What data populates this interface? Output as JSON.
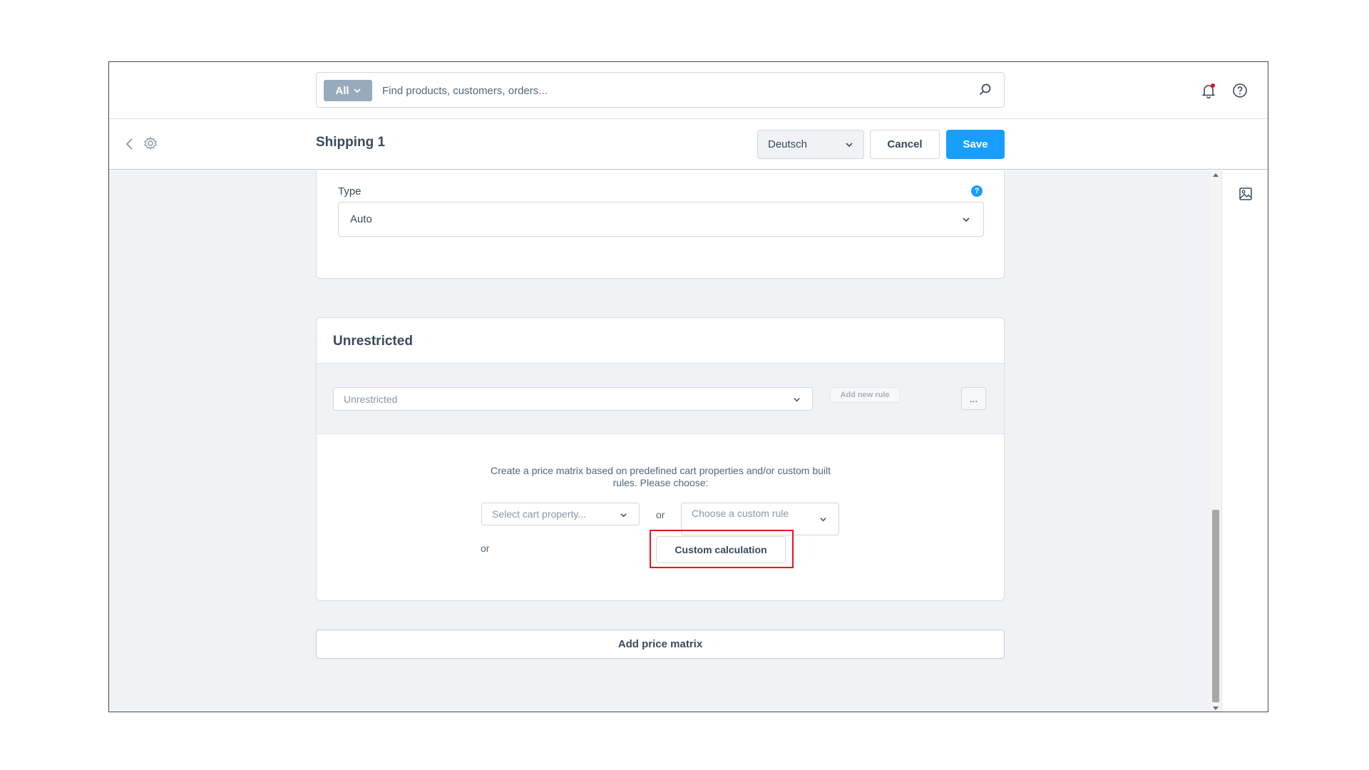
{
  "search": {
    "scope_label": "All",
    "placeholder": "Find products, customers, orders..."
  },
  "smartbar": {
    "title": "Shipping 1",
    "language": "Deutsch",
    "cancel_label": "Cancel",
    "save_label": "Save"
  },
  "type_card": {
    "label": "Type",
    "help_glyph": "?",
    "value": "Auto"
  },
  "unrestricted_card": {
    "title": "Unrestricted",
    "rule_value": "Unrestricted",
    "add_rule_label": "Add new rule",
    "more_label": "...",
    "description": "Create a price matrix based on predefined cart properties and/or custom built rules. Please choose:",
    "cart_property_placeholder": "Select cart property...",
    "or_label": "or",
    "custom_rule_placeholder": "Choose a custom rule",
    "custom_calc_label": "Custom calculation"
  },
  "add_matrix_label": "Add price matrix",
  "colors": {
    "primary": "#189eff",
    "highlight": "#e8141c",
    "notification": "#e8141c"
  },
  "icons": [
    "search-icon",
    "bell-icon",
    "help-circle-icon",
    "back-arrow-icon",
    "gear-icon",
    "chevron-down-icon",
    "image-icon"
  ]
}
